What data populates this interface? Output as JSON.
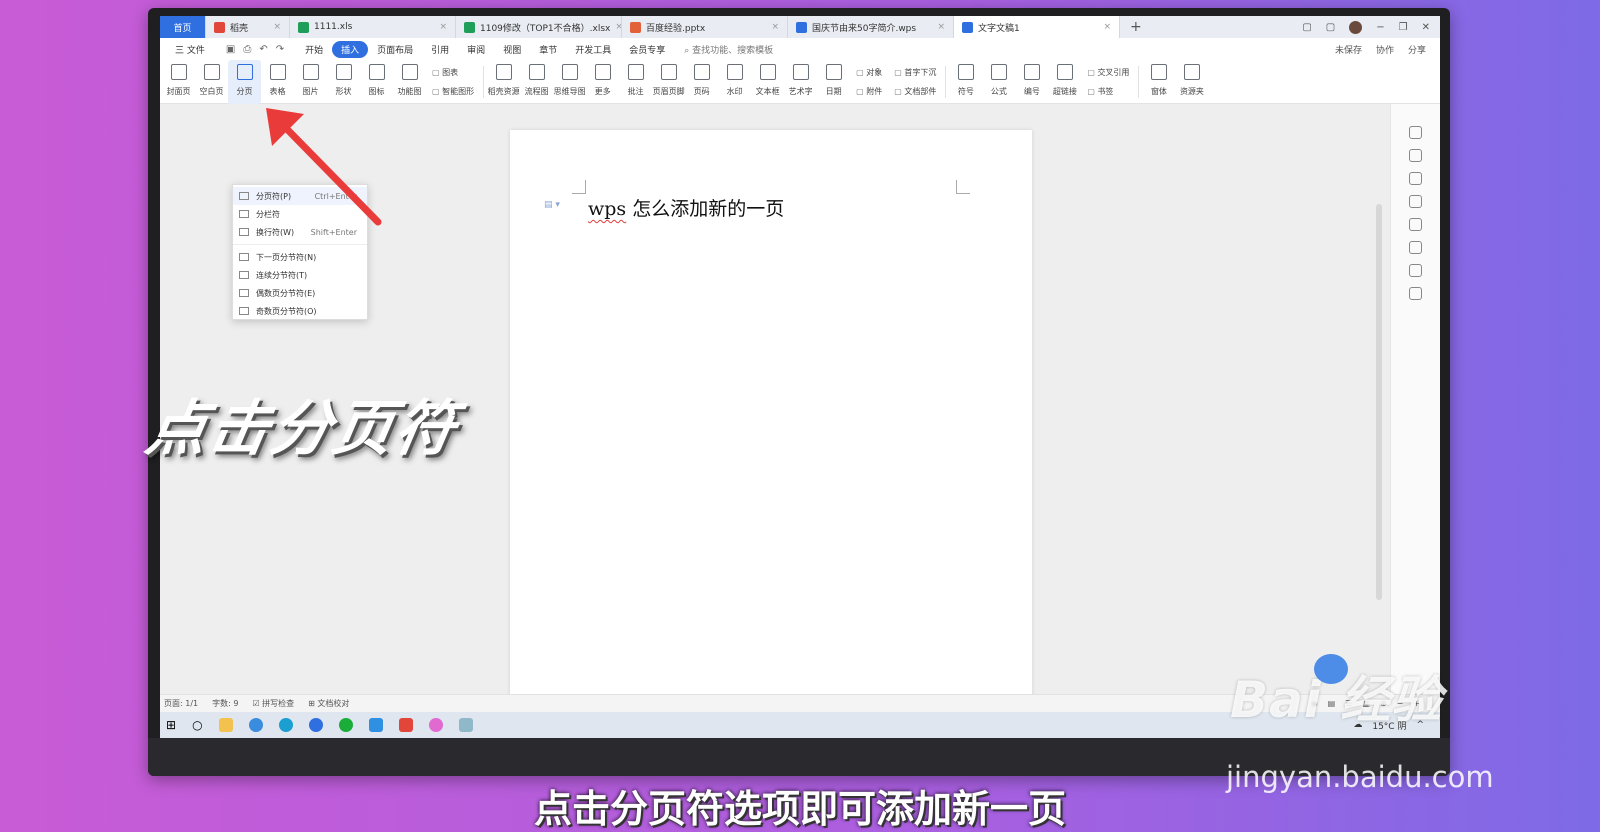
{
  "tabs": [
    {
      "label": "首页",
      "kind": "home",
      "color": "#2f6fe0"
    },
    {
      "label": "稻壳",
      "kind": "docer",
      "color": "#e0463a"
    },
    {
      "label": "1111.xls",
      "kind": "sheet",
      "color": "#1f9e5a"
    },
    {
      "label": "1109修改（TOP1不合格）.xlsx",
      "kind": "sheet",
      "color": "#1f9e5a"
    },
    {
      "label": "百度经验.pptx",
      "kind": "ppt",
      "color": "#e2603a"
    },
    {
      "label": "国庆节由来50字简介.wps",
      "kind": "doc",
      "color": "#2f6fe0"
    },
    {
      "label": "文字文稿1",
      "kind": "doc",
      "color": "#2f6fe0",
      "active": true
    }
  ],
  "newtab": "+",
  "menubar": {
    "file": "三 文件",
    "items": [
      "开始",
      "插入",
      "页面布局",
      "引用",
      "审阅",
      "视图",
      "章节",
      "开发工具",
      "会员专享"
    ],
    "active": "插入",
    "search": "查找功能、搜索模板",
    "right": [
      "未保存",
      "协作",
      "分享"
    ]
  },
  "ribbon": {
    "buttons": [
      "封面页",
      "空白页",
      "分页",
      "表格",
      "图片",
      "形状",
      "图标",
      "功能图"
    ],
    "pair1": [
      "图表",
      "智能图形"
    ],
    "buttons2": [
      "稻壳资源",
      "流程图",
      "思维导图",
      "更多",
      "批注",
      "页眉页脚",
      "页码",
      "水印",
      "文本框",
      "艺术字",
      "日期"
    ],
    "pair2": [
      "对象",
      "附件"
    ],
    "pair3": [
      "首字下沉",
      "文档部件"
    ],
    "buttons3": [
      "符号",
      "公式",
      "编号",
      "超链接"
    ],
    "pair4": [
      "交叉引用",
      "书签"
    ],
    "buttons4": [
      "窗体",
      "资源夹"
    ],
    "selected": "分页"
  },
  "dropdown": {
    "items": [
      {
        "label": "分页符(P)",
        "shortcut": "Ctrl+Enter",
        "highlighted": true
      },
      {
        "label": "分栏符",
        "shortcut": ""
      },
      {
        "label": "换行符(W)",
        "shortcut": "Shift+Enter"
      },
      {
        "label": "下一页分节符(N)",
        "shortcut": ""
      },
      {
        "label": "连续分节符(T)",
        "shortcut": ""
      },
      {
        "label": "偶数页分节符(E)",
        "shortcut": ""
      },
      {
        "label": "奇数页分节符(O)",
        "shortcut": ""
      }
    ]
  },
  "document": {
    "text_latin": "wps",
    "text_cjk": " 怎么添加新的一页"
  },
  "statusbar": {
    "page": "页面: 1/1",
    "words": "字数: 9",
    "spell": "拼写检查",
    "proof": "文档校对"
  },
  "taskbar": {
    "weather": "15°C 阴"
  },
  "overlay": {
    "caption": "点击分页符",
    "subtitle": "点击分页符选项即可添加新一页"
  },
  "watermark": {
    "logo": "Bai  经验",
    "url": "jingyan.baidu.com"
  }
}
